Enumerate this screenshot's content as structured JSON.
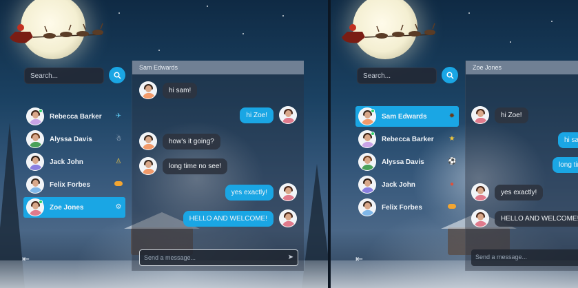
{
  "left_screen": {
    "search_placeholder": "Search...",
    "contacts": [
      {
        "name": "Rebecca Barker",
        "icon": "bird-icon",
        "active": false
      },
      {
        "name": "Alyssa Davis",
        "icon": "snowman-icon",
        "active": false
      },
      {
        "name": "Jack John",
        "icon": "person-icon",
        "active": false
      },
      {
        "name": "Felix Forbes",
        "icon": "pill-icon",
        "active": false
      },
      {
        "name": "Zoe Jones",
        "icon": "settings-icon",
        "active": true
      }
    ],
    "chat_header": "Sam Edwards",
    "messages": [
      {
        "dir": "in",
        "text": "hi sam!"
      },
      {
        "dir": "out",
        "text": "hi Zoe!"
      },
      {
        "dir": "in",
        "text": "how's it going?"
      },
      {
        "dir": "in",
        "text": "long time no see!"
      },
      {
        "dir": "out",
        "text": "yes exactly!"
      },
      {
        "dir": "out",
        "text": "HELLO AND WELCOME!"
      }
    ],
    "input_placeholder": "Send a message..."
  },
  "right_screen": {
    "search_placeholder": "Search...",
    "contacts": [
      {
        "name": "Sam Edwards",
        "icon": "gift-icon",
        "active": true
      },
      {
        "name": "Rebecca Barker",
        "icon": "star-icon",
        "active": false
      },
      {
        "name": "Alyssa Davis",
        "icon": "ball-icon",
        "active": false
      },
      {
        "name": "Jack John",
        "icon": "pin-icon",
        "active": false
      },
      {
        "name": "Felix Forbes",
        "icon": "pill-icon",
        "active": false
      }
    ],
    "chat_header": "Zoe Jones",
    "messages": [
      {
        "dir": "in",
        "text": "hi Zoe!"
      },
      {
        "dir": "out",
        "text": "hi sam!"
      },
      {
        "dir": "out",
        "text": "long time no see!"
      },
      {
        "dir": "in",
        "text": "yes exactly!"
      },
      {
        "dir": "in",
        "text": "HELLO AND WELCOME!"
      }
    ],
    "input_placeholder": "Send a message..."
  },
  "colors": {
    "accent": "#1aa6e4",
    "online": "#2fd06a"
  }
}
